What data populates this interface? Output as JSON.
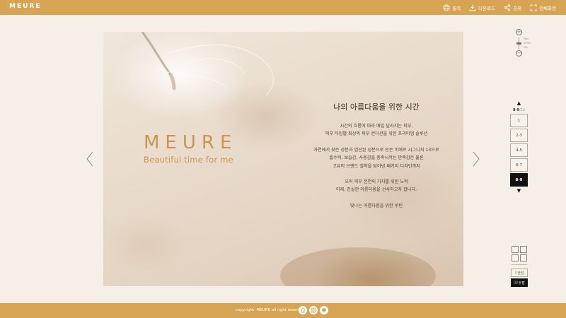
{
  "header": {
    "logo": "MEURE",
    "tools": [
      {
        "label": "출력",
        "icon": "print-icon"
      },
      {
        "label": "다운로드",
        "icon": "download-icon"
      },
      {
        "label": "공유",
        "icon": "share-icon"
      },
      {
        "label": "전체화면",
        "icon": "fullscreen-icon"
      }
    ]
  },
  "page": {
    "brand_name": "MEURE",
    "brand_tagline": "Beautiful time for me",
    "title": "나의 아름다움을 위한 시간",
    "paragraphs": [
      [
        "시간의 흐름에 따라 매일 달라지는 피부,",
        "피부 타입별 최상의 피부 컨디션을 위한 프리미엄 솔루션"
      ],
      [
        "자연에서 찾은 성분과 엄선된 성분으로 만든 미에르 시그니처 13으로",
        "흡수력, 보습감, 사용감을 충족시키는 만족감은 물론",
        "고유의 브랜드 철학을 담아낸 패키지 디자인까지"
      ],
      [
        "오직 피부 본연의 가치를 위한 노력",
        "이제, 진실한 아름다움을 선사하고자 합니다."
      ],
      [
        "빛나는 아름다움을 위한 루틴"
      ]
    ]
  },
  "zoom": {
    "labels": [
      "Max",
      "100%",
      "Min"
    ]
  },
  "pager": {
    "current": "8-9",
    "total": "/12",
    "pages": [
      "1",
      "2-3",
      "4-5",
      "6-7",
      "8-9"
    ],
    "active_index": 4
  },
  "view": {
    "single": "한장",
    "double": "두장"
  },
  "footer": {
    "copyright": "copyright. MEURE all right reserved."
  },
  "colors": {
    "accent": "#d7a453",
    "brand_text": "#c9964e",
    "background": "#f6efe7"
  }
}
